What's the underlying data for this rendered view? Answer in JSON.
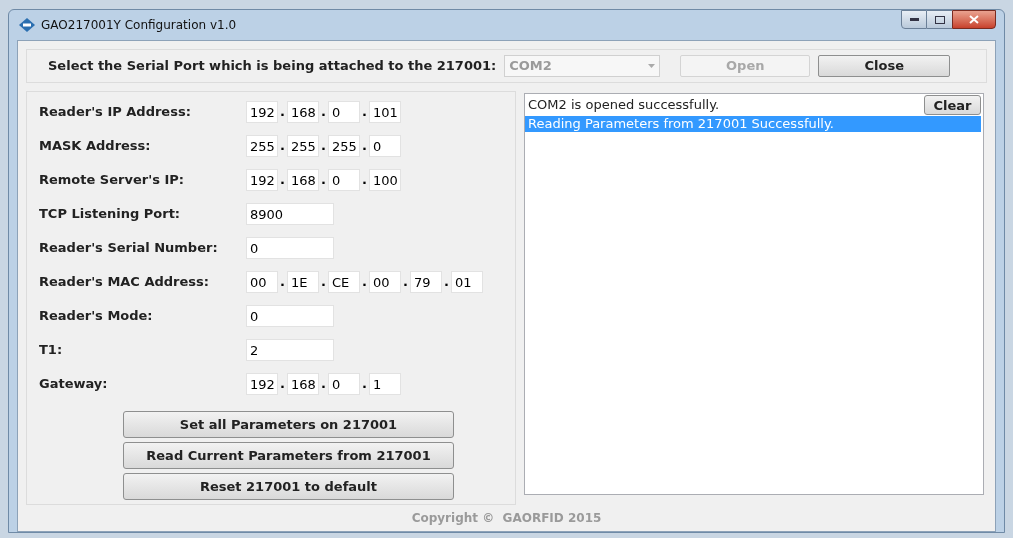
{
  "window": {
    "title": "GAO217001Y Configuration v1.0"
  },
  "port_bar": {
    "label": "Select the Serial Port which is being attached to the 217001:",
    "port": "COM2",
    "open_button": {
      "label": "Open",
      "disabled": true
    },
    "close_button": {
      "label": "Close",
      "disabled": false
    }
  },
  "separator": ".",
  "fields": [
    {
      "label": "Reader's IP Address:",
      "kind": "address",
      "parts": [
        "192",
        "168",
        "0",
        "101"
      ]
    },
    {
      "label": "MASK Address:",
      "kind": "address",
      "parts": [
        "255",
        "255",
        "255",
        "0"
      ]
    },
    {
      "label": "Remote Server's IP:",
      "kind": "address",
      "parts": [
        "192",
        "168",
        "0",
        "100"
      ]
    },
    {
      "label": "TCP Listening Port:",
      "kind": "single",
      "value": "8900"
    },
    {
      "label": "Reader's Serial Number:",
      "kind": "single",
      "value": "0"
    },
    {
      "label": "Reader's MAC Address:",
      "kind": "address",
      "parts": [
        "00",
        "1E",
        "CE",
        "00",
        "79",
        "01"
      ]
    },
    {
      "label": "Reader's Mode:",
      "kind": "single",
      "value": "0"
    },
    {
      "label": "T1:",
      "kind": "single",
      "value": "2"
    },
    {
      "label": "Gateway:",
      "kind": "address",
      "parts": [
        "192",
        "168",
        "0",
        "1"
      ]
    }
  ],
  "actions": [
    "Set all Parameters on 217001",
    "Read Current Parameters from 217001",
    "Reset 217001 to default"
  ],
  "log": {
    "clear_button": "Clear",
    "lines": [
      {
        "text": "COM2 is opened successfully.",
        "selected": false
      },
      {
        "text": "Reading Parameters from 217001 Successfully.",
        "selected": true
      }
    ]
  },
  "footer": "Copyright ©  GAORFID 2015"
}
